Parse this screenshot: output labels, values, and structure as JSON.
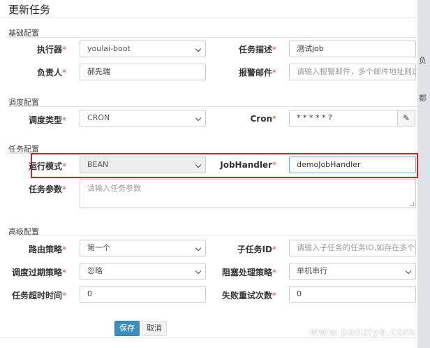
{
  "background": {
    "fragment_1": "负",
    "fragment_2": "都"
  },
  "dialog": {
    "title": "更新任务"
  },
  "sections": {
    "basic": "基础配置",
    "schedule": "调度配置",
    "task": "任务配置",
    "advanced": "高级配置"
  },
  "form": {
    "executor": {
      "label": "执行器",
      "value": "youlai-boot"
    },
    "job_desc": {
      "label": "任务描述",
      "value": "测试job"
    },
    "owner": {
      "label": "负责人",
      "value": "郝先瑞"
    },
    "alarm_email": {
      "label": "报警邮件",
      "placeholder": "请输入报警邮件，多个邮件地址则逗号分隔"
    },
    "schedule_type": {
      "label": "调度类型",
      "value": "CRON"
    },
    "cron": {
      "label": "Cron",
      "value": "* * * * * ?",
      "addon_icon": "edit-icon"
    },
    "run_mode": {
      "label": "运行模式",
      "value": "BEAN"
    },
    "job_handler": {
      "label": "JobHandler",
      "value": "demoJobHandler"
    },
    "job_params": {
      "label": "任务参数",
      "placeholder": "请输入任务参数"
    },
    "route_strategy": {
      "label": "路由策略",
      "value": "第一个"
    },
    "child_job_id": {
      "label": "子任务ID",
      "placeholder": "请输入子任务的任务ID,如存在多个则逗号分隔"
    },
    "misfire_strategy": {
      "label": "调度过期策略",
      "value": "忽略"
    },
    "block_strategy": {
      "label": "阻塞处理策略",
      "value": "单机串行"
    },
    "timeout": {
      "label": "任务超时时间",
      "value": "0"
    },
    "retry_count": {
      "label": "失败重试次数",
      "value": "0"
    }
  },
  "buttons": {
    "save": "保存",
    "cancel": "取消"
  },
  "watermark": "www.panziye.com",
  "colors": {
    "primary": "#3c8dbc",
    "highlight": "#c9262b",
    "required": "#d9534f"
  }
}
